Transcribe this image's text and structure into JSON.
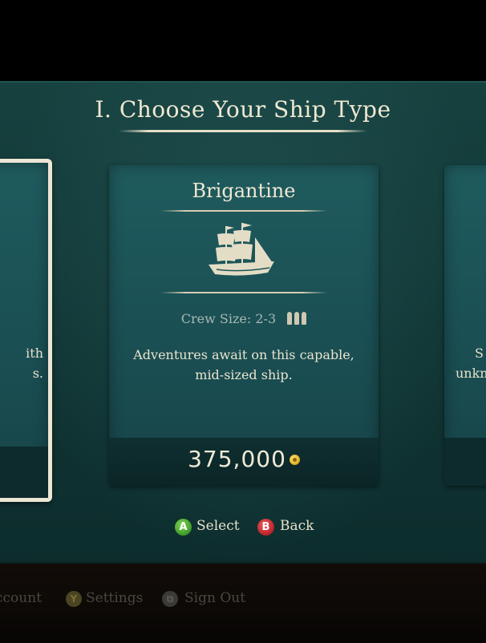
{
  "header": {
    "title": "I. Choose Your Ship Type"
  },
  "cards": {
    "left": {
      "desc_line1": "ith",
      "desc_line2": "s."
    },
    "center": {
      "name": "Brigantine",
      "crew_label": "Crew Size: 2-3",
      "crew_pips": 3,
      "description": "Adventures await on this capable, mid-sized ship.",
      "price": "375,000",
      "icon": "ship-icon",
      "currency_icon": "gold-coin-icon"
    },
    "right": {
      "desc_line1": "S",
      "desc_line2": "unkn"
    }
  },
  "prompts": {
    "select_button": "A",
    "select_label": "Select",
    "back_button": "B",
    "back_label": "Back",
    "select_color": "#3f9a2a",
    "back_color": "#b8232b"
  },
  "footer": {
    "account_label": "ccount",
    "settings_button": "Y",
    "settings_label": "Settings",
    "signout_label": "Sign Out",
    "signout_icon": "view-button-icon"
  }
}
